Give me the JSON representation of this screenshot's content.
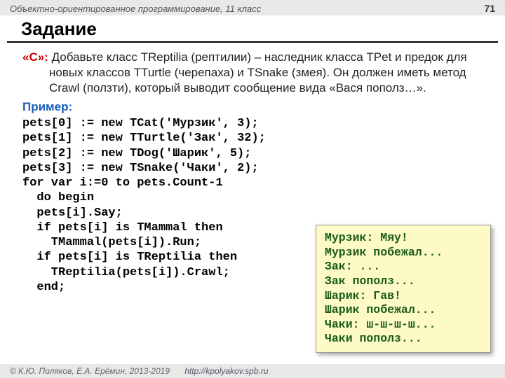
{
  "header": {
    "topic": "Объектно-ориентированное программирование, 11 класс",
    "page": "71"
  },
  "title": "Задание",
  "task": {
    "label": "«C»:",
    "text": " Добавьте класс TReptilia (рептилии) – наследник класса TPet и предок для новых классов TTurtle (черепаха) и TSnake (змея). Он должен иметь метод Crawl (ползти), который выводит сообщение вида «Вася пополз…»."
  },
  "example_label": "Пример:",
  "code": "pets[0] := new TCat('Мурзик', 3);\npets[1] := new TTurtle('Зак', 32);\npets[2] := new TDog('Шарик', 5);\npets[3] := new TSnake('Чаки', 2);\nfor var i:=0 to pets.Count-1\n  do begin\n  pets[i].Say;\n  if pets[i] is TMammal then\n    TMammal(pets[i]).Run;\n  if pets[i] is TReptilia then\n    TReptilia(pets[i]).Crawl;\n  end;",
  "output": "Мурзик: Мяу!\nМурзик побежал...\nЗак: ...\nЗак пополз...\nШарик: Гав!\nШарик побежал...\nЧаки: ш-ш-ш-ш...\nЧаки пополз...",
  "footer": {
    "copyright": "© К.Ю. Поляков, Е.А. Ерёмин, 2013-2019",
    "url": "http://kpolyakov.spb.ru"
  }
}
